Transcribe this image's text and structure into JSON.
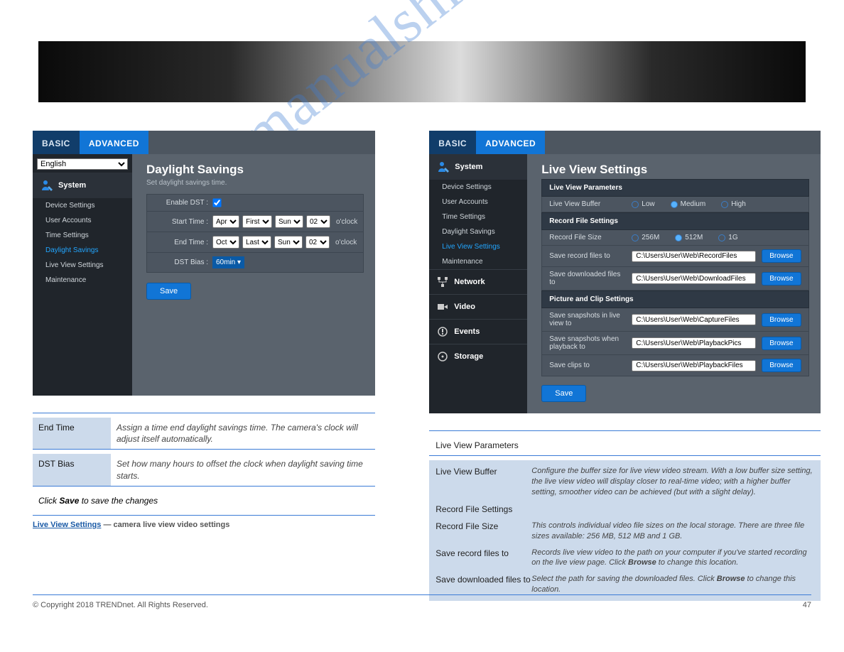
{
  "watermark": "manualshi",
  "left": {
    "tabs": {
      "basic": "BASIC",
      "advanced": "ADVANCED"
    },
    "language": "English",
    "sidebar": {
      "title": "System",
      "items": [
        {
          "label": "Device Settings",
          "active": false
        },
        {
          "label": "User Accounts",
          "active": false
        },
        {
          "label": "Time Settings",
          "active": false
        },
        {
          "label": "Daylight Savings",
          "active": true
        },
        {
          "label": "Live View Settings",
          "active": false
        },
        {
          "label": "Maintenance",
          "active": false
        }
      ]
    },
    "content": {
      "title": "Daylight Savings",
      "subtitle": "Set daylight savings time.",
      "rows": {
        "enable": "Enable DST :",
        "start": "Start Time :",
        "end": "End Time :",
        "bias": "DST Bias :"
      },
      "start": {
        "mon": "Apr",
        "wk": "First",
        "day": "Sun",
        "hr": "02",
        "suffix": "o'clock"
      },
      "end": {
        "mon": "Oct",
        "wk": "Last",
        "day": "Sun",
        "hr": "02",
        "suffix": "o'clock"
      },
      "bias": "60min",
      "save": "Save"
    },
    "descTable": {
      "r1k": "End Time",
      "r1v": "Assign a time end daylight savings time. The camera's clock will adjust itself automatically.",
      "r2k": "DST Bias",
      "r2v": "Set how many hours to offset the clock when daylight saving time starts."
    },
    "link": {
      "label": "Live View Settings",
      "text": " — camera live view video settings"
    },
    "clickText": "Click <b>Save</b> to save the changes"
  },
  "right": {
    "tabs": {
      "basic": "BASIC",
      "advanced": "ADVANCED"
    },
    "sidebar": {
      "system": "System",
      "items": [
        {
          "label": "Device Settings"
        },
        {
          "label": "User Accounts"
        },
        {
          "label": "Time Settings"
        },
        {
          "label": "Daylight Savings"
        },
        {
          "label": "Live View Settings",
          "active": true
        },
        {
          "label": "Maintenance"
        }
      ],
      "groups": [
        "Network",
        "Video",
        "Events",
        "Storage"
      ]
    },
    "content": {
      "title": "Live View Settings",
      "sect1": "Live View Parameters",
      "row1lbl": "Live View Buffer",
      "row1opts": [
        "Low",
        "Medium",
        "High"
      ],
      "row1sel": 1,
      "sect2": "Record File Settings",
      "row2lbl": "Record File Size",
      "row2opts": [
        "256M",
        "512M",
        "1G"
      ],
      "row2sel": 1,
      "row3lbl": "Save record files to",
      "row3val": "C:\\Users\\User\\Web\\RecordFiles",
      "row4lbl": "Save downloaded files to",
      "row4val": "C:\\Users\\User\\Web\\DownloadFiles",
      "sect3": "Picture and Clip Settings",
      "row5lbl": "Save snapshots in live view to",
      "row5val": "C:\\Users\\User\\Web\\CaptureFiles",
      "row6lbl": "Save snapshots when playback to",
      "row6val": "C:\\Users\\User\\Web\\PlaybackPics",
      "row7lbl": "Save clips to",
      "row7val": "C:\\Users\\User\\Web\\PlaybackFiles",
      "browse": "Browse",
      "save": "Save"
    },
    "docHeading": "Live View Parameters",
    "definitions": [
      {
        "k": "Live View Buffer",
        "v": "Configure the buffer size for live view video stream. With a low buffer size setting, the live view video will display closer to real-time video; with a higher buffer setting, smoother video can be achieved (but with a slight delay)."
      },
      {
        "k": "Record File Settings",
        "v": ""
      },
      {
        "k": "Record File Size",
        "v": "This controls individual video file sizes on the local storage. There are three file sizes available: 256 MB, 512 MB and 1 GB."
      },
      {
        "k": "Save record files to",
        "v": "Records live view video to the path on your computer if you've started recording on the live view page. Click <b>Browse</b> to change this location."
      },
      {
        "k": "Save downloaded files to",
        "v": "Select the path for saving the downloaded files. Click <b>Browse</b> to change this location."
      }
    ]
  },
  "footer": {
    "copyright": "© Copyright 2018 TRENDnet. All Rights Reserved.",
    "page": "47"
  }
}
